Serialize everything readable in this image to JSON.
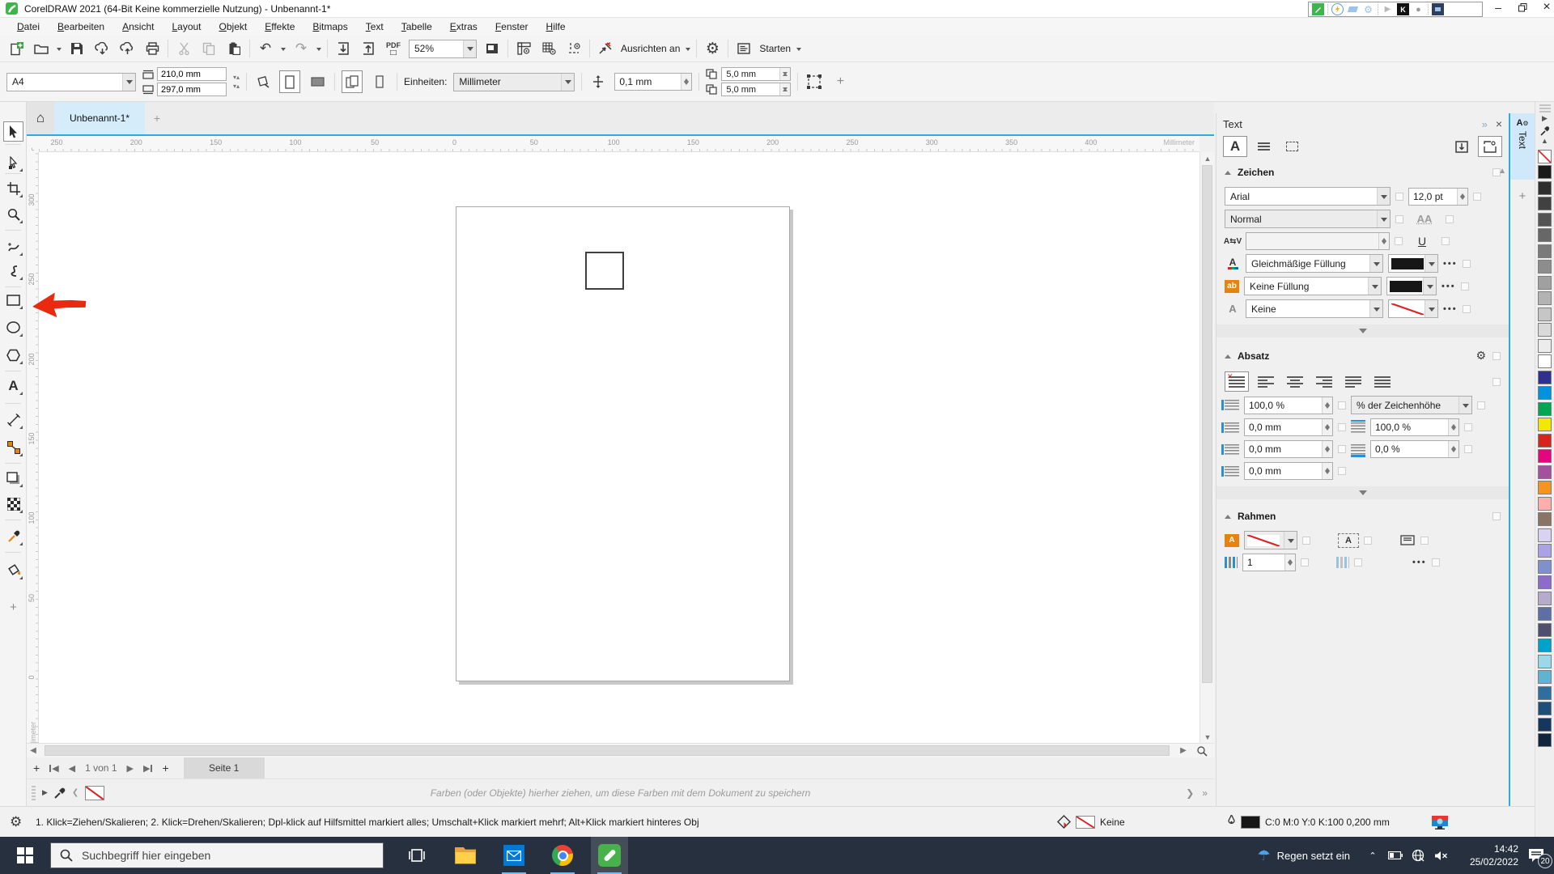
{
  "titlebar": {
    "title": "CorelDRAW 2021 (64-Bit Keine kommerzielle Nutzung) - Unbenannt-1*"
  },
  "menubar": {
    "items": [
      "Datei",
      "Bearbeiten",
      "Ansicht",
      "Layout",
      "Objekt",
      "Effekte",
      "Bitmaps",
      "Text",
      "Tabelle",
      "Extras",
      "Fenster",
      "Hilfe"
    ]
  },
  "toolbar": {
    "zoom_level": "52%",
    "snap_label": "Ausrichten an",
    "launch_label": "Starten",
    "pdf_label": "PDF"
  },
  "property_bar": {
    "page_size": "A4",
    "page_width": "210,0 mm",
    "page_height": "297,0 mm",
    "units_label": "Einheiten:",
    "units_value": "Millimeter",
    "nudge_offset": "0,1 mm",
    "duplicate_x": "5,0 mm",
    "duplicate_y": "5,0 mm"
  },
  "doc_tabs": {
    "active_tab": "Unbenannt-1*"
  },
  "rulers": {
    "h_labels": [
      "250",
      "200",
      "150",
      "100",
      "50",
      "0",
      "50",
      "100",
      "150",
      "200",
      "250",
      "300",
      "350",
      "400"
    ],
    "v_labels": [
      "300",
      "250",
      "200",
      "150",
      "100",
      "50",
      "0"
    ],
    "h_unit": "Millimeter",
    "v_unit": "Millimeter"
  },
  "docker": {
    "title": "Text",
    "side_tab_label": "Text",
    "zeichen": {
      "title": "Zeichen",
      "font_family": "Arial",
      "font_size": "12,0 pt",
      "font_style": "Normal",
      "fill_type": "Gleichmäßige Füllung",
      "background_fill": "Keine Füllung",
      "outline_width": "Keine"
    },
    "absatz": {
      "title": "Absatz",
      "line_spacing": "100,0 %",
      "spacing_unit": "% der Zeichenhöhe",
      "space_before": "0,0 mm",
      "word_spacing": "100,0 %",
      "space_after": "0,0 mm",
      "char_spacing": "0,0 %",
      "first_line_indent": "0,0 mm"
    },
    "rahmen": {
      "title": "Rahmen",
      "columns": "1"
    }
  },
  "palette": {
    "colors": [
      "none",
      "#1a1a1a",
      "#2e2e2e",
      "#414141",
      "#545454",
      "#676767",
      "#7a7a7a",
      "#8d8d8d",
      "#a0a0a0",
      "#b3b3b3",
      "#c6c6c6",
      "#d9d9d9",
      "#ececec",
      "#ffffff",
      "#2e3192",
      "#0093dd",
      "#00a651",
      "#f5e800",
      "#d6251d",
      "#e5067f",
      "#a3509d",
      "#f7941d",
      "#ffaeae",
      "#8a7463",
      "#d9d2f2",
      "#aba1e6",
      "#8090cc",
      "#8d6cc9",
      "#b4abcd",
      "#5e6fa6",
      "#50506e",
      "#00a3c8",
      "#9ad9ea",
      "#5fb3d4",
      "#2f6f9f",
      "#1f4e79",
      "#17365d",
      "#10243e"
    ]
  },
  "page_nav": {
    "indicator": "1 von 1",
    "page_tab": "Seite 1"
  },
  "doc_palette": {
    "hint": "Farben (oder Objekte) hierher ziehen, um diese Farben mit dem Dokument zu speichern"
  },
  "status_bar": {
    "tool_hint": "1. Klick=Ziehen/Skalieren; 2. Klick=Drehen/Skalieren; Dpl-klick auf Hilfsmittel markiert alles; Umschalt+Klick markiert mehrf; Alt+Klick markiert hinteres Obj",
    "outline_value": "Keine",
    "fill_info": "C:0 M:0 Y:0 K:100  0,200 mm"
  },
  "taskbar": {
    "search_placeholder": "Suchbegriff hier eingeben",
    "weather_text": "Regen setzt ein",
    "clock_time": "14:42",
    "clock_date": "25/02/2022",
    "notification_count": "20"
  }
}
